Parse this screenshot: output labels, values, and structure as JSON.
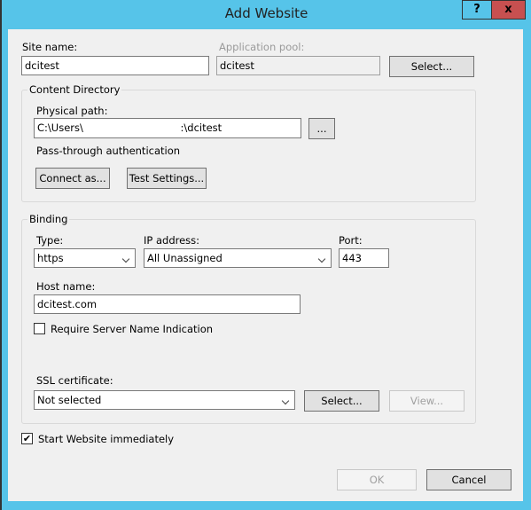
{
  "window": {
    "title": "Add Website",
    "help_label": "?",
    "close_label": "x"
  },
  "site_name": {
    "label": "Site name:",
    "value": "dcitest"
  },
  "application_pool": {
    "label": "Application pool:",
    "value": "dcitest",
    "select_label": "Select..."
  },
  "content_directory": {
    "legend": "Content Directory",
    "physical_path_label": "Physical path:",
    "physical_path_value": "C:\\Users\\                              :\\dcitest",
    "browse_label": "...",
    "auth_text": "Pass-through authentication",
    "connect_as_label": "Connect as...",
    "test_settings_label": "Test Settings..."
  },
  "binding": {
    "legend": "Binding",
    "type_label": "Type:",
    "type_value": "https",
    "ip_label": "IP address:",
    "ip_value": "All Unassigned",
    "port_label": "Port:",
    "port_value": "443",
    "host_label": "Host name:",
    "host_value": "dcitest.com",
    "sni_label": "Require Server Name Indication",
    "sni_checked": false,
    "ssl_label": "SSL certificate:",
    "ssl_value": "Not selected",
    "ssl_select_label": "Select...",
    "ssl_view_label": "View..."
  },
  "start_immediately": {
    "label": "Start Website immediately",
    "checked": true,
    "mark": "✔"
  },
  "footer": {
    "ok_label": "OK",
    "cancel_label": "Cancel"
  },
  "colors": {
    "frame": "#56c4e9",
    "close": "#c75050"
  }
}
